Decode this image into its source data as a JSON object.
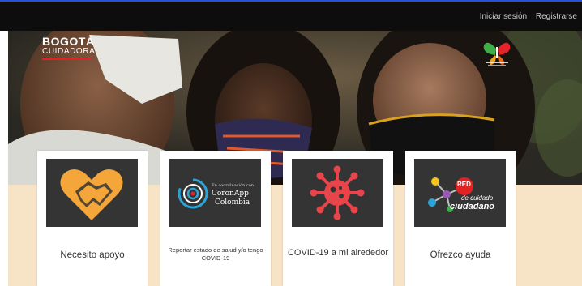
{
  "header": {
    "login": "Iniciar sesión",
    "register": "Registrarse"
  },
  "logo": {
    "line1": "BOGOTÁ",
    "line2": "CUIDADORA"
  },
  "cards": [
    {
      "label": "Necesito apoyo",
      "icon": "heart-handshake-icon"
    },
    {
      "label": "Reportar estado de salud y/o tengo COVID-19",
      "image_text_small": "En coordinación con",
      "image_text_1": "CoronApp",
      "image_text_2": "Colombia",
      "icon": "coronapp-logo"
    },
    {
      "label": "COVID-19 a mi alrededor",
      "icon": "virus-icon"
    },
    {
      "label": "Ofrezco ayuda",
      "image_badge": "RED",
      "image_text_1": "de cuidado",
      "image_text_2": "ciudadano",
      "icon": "network-icon"
    }
  ],
  "colors": {
    "topbar": "#0d0d0d",
    "accent_line": "#2a4fd6",
    "band": "#f7e3c6",
    "card_image_bg": "#343434",
    "heart": "#f5a63a",
    "virus": "#e8454b",
    "red_badge": "#e02323"
  }
}
